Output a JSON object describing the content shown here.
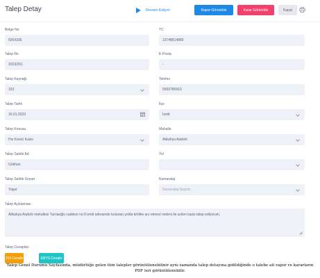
{
  "header": {
    "title": "Talep Detay",
    "status_text": "Devam Ediyor",
    "report_button": "Rapor Görüntüle",
    "decision_button": "Karar Görüntüle",
    "close_button": "Kapat"
  },
  "form": {
    "belge_no": {
      "label": "Belge No",
      "value": "8264336"
    },
    "tc": {
      "label": "TC",
      "value": "10748814880"
    },
    "talep_no": {
      "label": "Talep No",
      "value": "2023/261"
    },
    "eposta": {
      "label": "E-Posta",
      "value": "-"
    },
    "talep_kaynagi": {
      "label": "Talep Kaynağı",
      "value": "153"
    },
    "telefon": {
      "label": "Telefon",
      "value": "5550780910"
    },
    "talep_tarihi": {
      "label": "Talep Tarihi",
      "value": "16.01.2023"
    },
    "ilce": {
      "label": "İlçe",
      "value": "İzmit"
    },
    "talep_konusu": {
      "label": "Talep Konusu",
      "value": "Hız Kesici Kasis"
    },
    "mahalle": {
      "label": "Mahalle",
      "value": "Alikahya Atatürk"
    },
    "talep_sahibi_ad": {
      "label": "Talep Sahibi Ad",
      "value": "Gökhan"
    },
    "yol": {
      "label": "Yol",
      "value": ""
    },
    "talep_sahibi_soyad": {
      "label": "Talep Sahibi Soyad",
      "value": "Yaşar"
    },
    "numarataj": {
      "label": "Numarataj",
      "placeholder": "Numarataj Seçiniz"
    },
    "talep_aciklamasi": {
      "label": "Talep Açıklaması",
      "value": "Alikahya Atatürk mahallesi Turnaoğlu caddesi no:9 izmit adresinde bulunan yolda tehlike arz etmesi nedeni ile acilen kasis talep ediyorum."
    },
    "talep_cevaplari": {
      "label": "Talep Cevapları",
      "button_153": "153 Cevabı",
      "button_ebys": "EBYS Cevabı"
    }
  },
  "caption": {
    "line1": "Talep Genel Durumu Sayfasında, müdürlüğe gelen tüm talepler görüntülenebilinir aynı zamanda talep detayına gidildiğinde o talebe ait rapor ve kararların",
    "line2": "PDF leri görüntülenebilir."
  },
  "colors": {
    "primary": "#1e88e5",
    "danger": "#f1416c",
    "warning": "#f59e0b",
    "info": "#1fc4c4",
    "field_bg": "#eef1f8"
  }
}
